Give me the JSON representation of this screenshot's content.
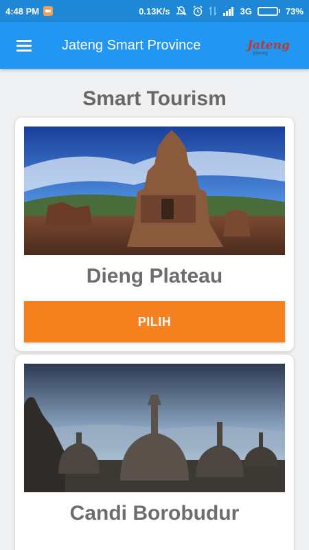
{
  "status_bar": {
    "time": "4:48 PM",
    "network_speed": "0.13K/s",
    "network_type": "3G",
    "battery_percent": "73%",
    "battery_level": 0.73,
    "icons": [
      "notification-badge-icon",
      "mute-icon",
      "alarm-icon",
      "data-transfer-icon",
      "signal-icon",
      "battery-icon"
    ]
  },
  "app_bar": {
    "title": "Jateng Smart Province",
    "logo_text": "Jateng",
    "logo_subtext": "gayeng"
  },
  "page": {
    "section_title": "Smart Tourism"
  },
  "destinations": [
    {
      "name": "Dieng Plateau",
      "button_label": "PILIH",
      "image": "temple-photo"
    },
    {
      "name": "Candi Borobudur",
      "image": "stupa-photo"
    }
  ],
  "colors": {
    "status_bar": "#1e88d6",
    "app_bar": "#2196f3",
    "button": "#f5821f",
    "background": "#eef0f2",
    "text_gray": "#6d6d6d"
  }
}
